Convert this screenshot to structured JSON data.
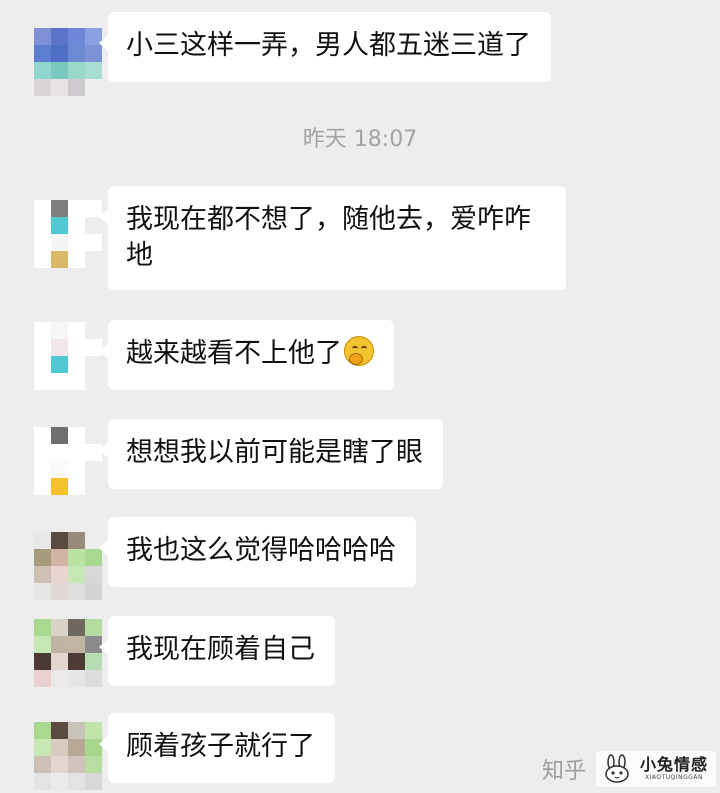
{
  "chat": {
    "timestamp": "昨天 18:07",
    "messages": [
      {
        "text": "小三这样一弄，男人都五迷三道了",
        "emoji": ""
      },
      {
        "text": "我现在都不想了，随他去，爱咋咋地",
        "emoji": ""
      },
      {
        "text": "越来越看不上他了",
        "emoji": "thinking-face-icon"
      },
      {
        "text": "想想我以前可能是瞎了眼",
        "emoji": ""
      },
      {
        "text": "我也这么觉得哈哈哈哈",
        "emoji": ""
      },
      {
        "text": "我现在顾着自己",
        "emoji": ""
      },
      {
        "text": "顾着孩子就行了",
        "emoji": ""
      }
    ]
  },
  "watermark": {
    "zhihu": "知乎",
    "brand_title": "小兔情感",
    "brand_sub": "XIAOTUQINGGAN"
  }
}
